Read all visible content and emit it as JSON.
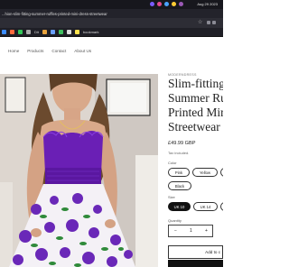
{
  "browser": {
    "date": "Aug 29 2023",
    "tab_title": "...hion-slim-fitting-summer-ruffles-printed-mini-dress-streetwear",
    "bookmarks": [
      "Dit",
      "bookmark"
    ]
  },
  "site_nav": {
    "links": [
      "Home",
      "Products",
      "Contact",
      "About Us"
    ]
  },
  "product": {
    "vendor": "MODERNDRESS",
    "title_lines": [
      "Slim-fitting",
      "Summer Ru",
      "Printed Min",
      "Streetwear"
    ],
    "price": "£49.99 GBP",
    "tax_note": "Tax included.",
    "color_label": "Color",
    "colors": [
      "Pink",
      "Yellow",
      "Black"
    ],
    "size_label": "Size",
    "sizes": [
      "UK 10",
      "UK 14"
    ],
    "quantity_label": "Quantity",
    "quantity": "1",
    "qty_minus": "−",
    "qty_plus": "+",
    "add_to_cart": "Add to c"
  },
  "colors": {
    "dress_purple": "#6a1fb5",
    "accent_dark": "#111111"
  }
}
